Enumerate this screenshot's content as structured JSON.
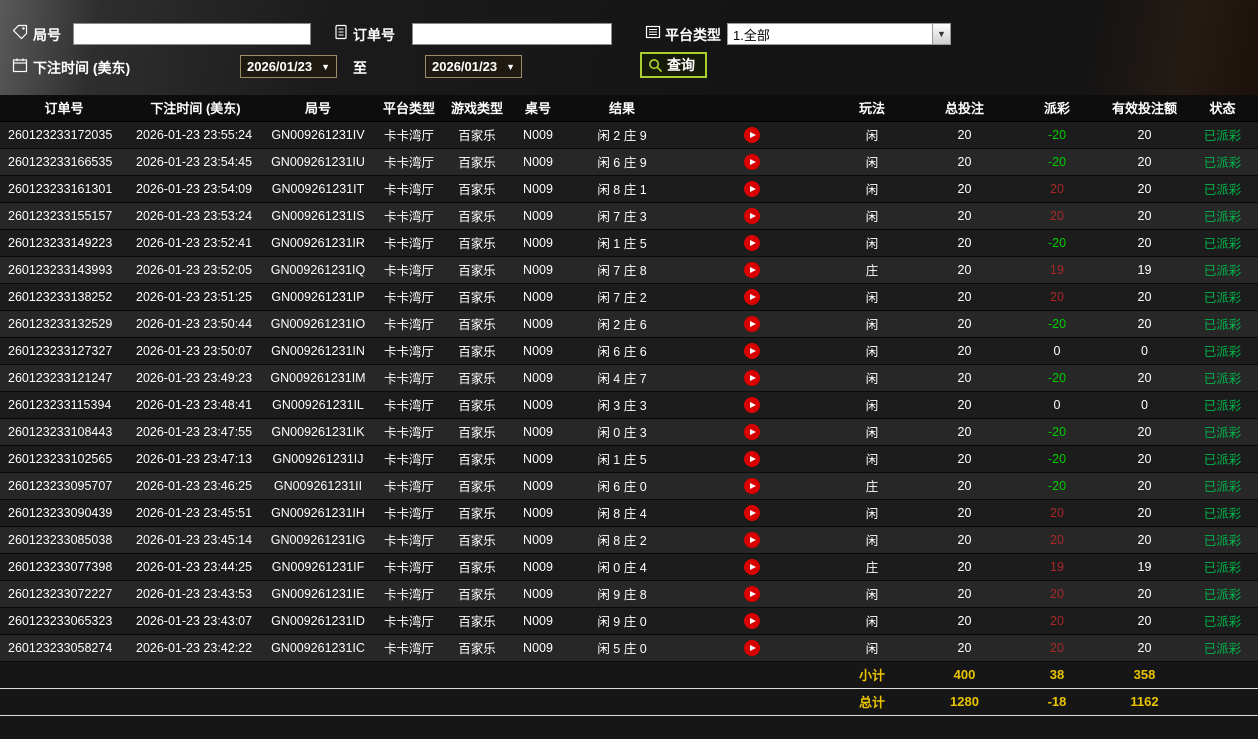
{
  "filters": {
    "round_no_label": "局号",
    "round_no_value": "",
    "order_no_label": "订单号",
    "order_no_value": "",
    "platform_type_label": "平台类型",
    "platform_type_value": "1.全部",
    "bet_time_label": "下注时间 (美东)",
    "date_from": "2026/01/23",
    "to_label": "至",
    "date_to": "2026/01/23",
    "query_label": "查询"
  },
  "icons": {
    "round_no": "tag-icon",
    "order_no": "order-icon",
    "platform_type": "list-icon",
    "bet_time": "calendar-icon",
    "query": "search-icon",
    "replay": "play-icon",
    "accent_green": "#a9ce2f",
    "replay_red": "#d80000"
  },
  "table": {
    "headers": [
      "订单号",
      "下注时间 (美东)",
      "局号",
      "平台类型",
      "游戏类型",
      "桌号",
      "结果",
      "",
      "玩法",
      "总投注",
      "派彩",
      "有效投注额",
      "状态"
    ],
    "rows": [
      {
        "order_no": "260123233172035",
        "bet_time": "2026-01-23 23:55:24",
        "round_no": "GN009261231IV",
        "platform": "卡卡湾厅",
        "game": "百家乐",
        "table_no": "N009",
        "result": "闲 2 庄 9",
        "play": "闲",
        "total_bet": "20",
        "payout": "-20",
        "payout_color": "neg",
        "valid_bet": "20",
        "status": "已派彩"
      },
      {
        "order_no": "260123233166535",
        "bet_time": "2026-01-23 23:54:45",
        "round_no": "GN009261231IU",
        "platform": "卡卡湾厅",
        "game": "百家乐",
        "table_no": "N009",
        "result": "闲 6 庄 9",
        "play": "闲",
        "total_bet": "20",
        "payout": "-20",
        "payout_color": "neg",
        "valid_bet": "20",
        "status": "已派彩"
      },
      {
        "order_no": "260123233161301",
        "bet_time": "2026-01-23 23:54:09",
        "round_no": "GN009261231IT",
        "platform": "卡卡湾厅",
        "game": "百家乐",
        "table_no": "N009",
        "result": "闲 8 庄 1",
        "play": "闲",
        "total_bet": "20",
        "payout": "20",
        "payout_color": "pos",
        "valid_bet": "20",
        "status": "已派彩"
      },
      {
        "order_no": "260123233155157",
        "bet_time": "2026-01-23 23:53:24",
        "round_no": "GN009261231IS",
        "platform": "卡卡湾厅",
        "game": "百家乐",
        "table_no": "N009",
        "result": "闲 7 庄 3",
        "play": "闲",
        "total_bet": "20",
        "payout": "20",
        "payout_color": "pos",
        "valid_bet": "20",
        "status": "已派彩"
      },
      {
        "order_no": "260123233149223",
        "bet_time": "2026-01-23 23:52:41",
        "round_no": "GN009261231IR",
        "platform": "卡卡湾厅",
        "game": "百家乐",
        "table_no": "N009",
        "result": "闲 1 庄 5",
        "play": "闲",
        "total_bet": "20",
        "payout": "-20",
        "payout_color": "neg",
        "valid_bet": "20",
        "status": "已派彩"
      },
      {
        "order_no": "260123233143993",
        "bet_time": "2026-01-23 23:52:05",
        "round_no": "GN009261231IQ",
        "platform": "卡卡湾厅",
        "game": "百家乐",
        "table_no": "N009",
        "result": "闲 7 庄 8",
        "play": "庄",
        "total_bet": "20",
        "payout": "19",
        "payout_color": "pos",
        "valid_bet": "19",
        "status": "已派彩"
      },
      {
        "order_no": "260123233138252",
        "bet_time": "2026-01-23 23:51:25",
        "round_no": "GN009261231IP",
        "platform": "卡卡湾厅",
        "game": "百家乐",
        "table_no": "N009",
        "result": "闲 7 庄 2",
        "play": "闲",
        "total_bet": "20",
        "payout": "20",
        "payout_color": "pos",
        "valid_bet": "20",
        "status": "已派彩"
      },
      {
        "order_no": "260123233132529",
        "bet_time": "2026-01-23 23:50:44",
        "round_no": "GN009261231IO",
        "platform": "卡卡湾厅",
        "game": "百家乐",
        "table_no": "N009",
        "result": "闲 2 庄 6",
        "play": "闲",
        "total_bet": "20",
        "payout": "-20",
        "payout_color": "neg",
        "valid_bet": "20",
        "status": "已派彩"
      },
      {
        "order_no": "260123233127327",
        "bet_time": "2026-01-23 23:50:07",
        "round_no": "GN009261231IN",
        "platform": "卡卡湾厅",
        "game": "百家乐",
        "table_no": "N009",
        "result": "闲 6 庄 6",
        "play": "闲",
        "total_bet": "20",
        "payout": "0",
        "payout_color": "zero",
        "valid_bet": "0",
        "status": "已派彩"
      },
      {
        "order_no": "260123233121247",
        "bet_time": "2026-01-23 23:49:23",
        "round_no": "GN009261231IM",
        "platform": "卡卡湾厅",
        "game": "百家乐",
        "table_no": "N009",
        "result": "闲 4 庄 7",
        "play": "闲",
        "total_bet": "20",
        "payout": "-20",
        "payout_color": "neg",
        "valid_bet": "20",
        "status": "已派彩"
      },
      {
        "order_no": "260123233115394",
        "bet_time": "2026-01-23 23:48:41",
        "round_no": "GN009261231IL",
        "platform": "卡卡湾厅",
        "game": "百家乐",
        "table_no": "N009",
        "result": "闲 3 庄 3",
        "play": "闲",
        "total_bet": "20",
        "payout": "0",
        "payout_color": "zero",
        "valid_bet": "0",
        "status": "已派彩"
      },
      {
        "order_no": "260123233108443",
        "bet_time": "2026-01-23 23:47:55",
        "round_no": "GN009261231IK",
        "platform": "卡卡湾厅",
        "game": "百家乐",
        "table_no": "N009",
        "result": "闲 0 庄 3",
        "play": "闲",
        "total_bet": "20",
        "payout": "-20",
        "payout_color": "neg",
        "valid_bet": "20",
        "status": "已派彩"
      },
      {
        "order_no": "260123233102565",
        "bet_time": "2026-01-23 23:47:13",
        "round_no": "GN009261231IJ",
        "platform": "卡卡湾厅",
        "game": "百家乐",
        "table_no": "N009",
        "result": "闲 1 庄 5",
        "play": "闲",
        "total_bet": "20",
        "payout": "-20",
        "payout_color": "neg",
        "valid_bet": "20",
        "status": "已派彩"
      },
      {
        "order_no": "260123233095707",
        "bet_time": "2026-01-23 23:46:25",
        "round_no": "GN009261231II",
        "platform": "卡卡湾厅",
        "game": "百家乐",
        "table_no": "N009",
        "result": "闲 6 庄 0",
        "play": "庄",
        "total_bet": "20",
        "payout": "-20",
        "payout_color": "neg",
        "valid_bet": "20",
        "status": "已派彩"
      },
      {
        "order_no": "260123233090439",
        "bet_time": "2026-01-23 23:45:51",
        "round_no": "GN009261231IH",
        "platform": "卡卡湾厅",
        "game": "百家乐",
        "table_no": "N009",
        "result": "闲 8 庄 4",
        "play": "闲",
        "total_bet": "20",
        "payout": "20",
        "payout_color": "pos",
        "valid_bet": "20",
        "status": "已派彩"
      },
      {
        "order_no": "260123233085038",
        "bet_time": "2026-01-23 23:45:14",
        "round_no": "GN009261231IG",
        "platform": "卡卡湾厅",
        "game": "百家乐",
        "table_no": "N009",
        "result": "闲 8 庄 2",
        "play": "闲",
        "total_bet": "20",
        "payout": "20",
        "payout_color": "pos",
        "valid_bet": "20",
        "status": "已派彩"
      },
      {
        "order_no": "260123233077398",
        "bet_time": "2026-01-23 23:44:25",
        "round_no": "GN009261231IF",
        "platform": "卡卡湾厅",
        "game": "百家乐",
        "table_no": "N009",
        "result": "闲 0 庄 4",
        "play": "庄",
        "total_bet": "20",
        "payout": "19",
        "payout_color": "pos",
        "valid_bet": "19",
        "status": "已派彩"
      },
      {
        "order_no": "260123233072227",
        "bet_time": "2026-01-23 23:43:53",
        "round_no": "GN009261231IE",
        "platform": "卡卡湾厅",
        "game": "百家乐",
        "table_no": "N009",
        "result": "闲 9 庄 8",
        "play": "闲",
        "total_bet": "20",
        "payout": "20",
        "payout_color": "pos",
        "valid_bet": "20",
        "status": "已派彩"
      },
      {
        "order_no": "260123233065323",
        "bet_time": "2026-01-23 23:43:07",
        "round_no": "GN009261231ID",
        "platform": "卡卡湾厅",
        "game": "百家乐",
        "table_no": "N009",
        "result": "闲 9 庄 0",
        "play": "闲",
        "total_bet": "20",
        "payout": "20",
        "payout_color": "pos",
        "valid_bet": "20",
        "status": "已派彩"
      },
      {
        "order_no": "260123233058274",
        "bet_time": "2026-01-23 23:42:22",
        "round_no": "GN009261231IC",
        "platform": "卡卡湾厅",
        "game": "百家乐",
        "table_no": "N009",
        "result": "闲 5 庄 0",
        "play": "闲",
        "total_bet": "20",
        "payout": "20",
        "payout_color": "pos",
        "valid_bet": "20",
        "status": "已派彩"
      }
    ],
    "subtotal": {
      "label": "小计",
      "total_bet": "400",
      "payout": "38",
      "valid_bet": "358"
    },
    "total": {
      "label": "总计",
      "total_bet": "1280",
      "payout": "-18",
      "valid_bet": "1162"
    }
  }
}
